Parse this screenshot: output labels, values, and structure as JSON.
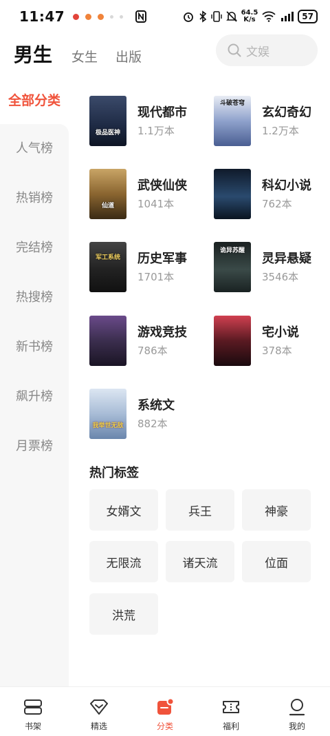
{
  "status_bar": {
    "time": "11:47",
    "speed_value": "64.5",
    "speed_unit": "K/s",
    "battery": "57"
  },
  "header": {
    "tabs": [
      {
        "label": "男生",
        "active": true
      },
      {
        "label": "女生",
        "active": false
      },
      {
        "label": "出版",
        "active": false
      }
    ],
    "search_placeholder": "文娱"
  },
  "sidebar": {
    "active": "全部分类",
    "items": [
      "人气榜",
      "热销榜",
      "完结榜",
      "热搜榜",
      "新书榜",
      "飙升榜",
      "月票榜"
    ]
  },
  "categories": [
    {
      "name": "现代都市",
      "count": "1.1万本",
      "cover_title": "极品医神",
      "cover_color": "#1e2a44"
    },
    {
      "name": "玄幻奇幻",
      "count": "1.2万本",
      "cover_title": "斗破苍穹",
      "cover_color": "#6b7fb0"
    },
    {
      "name": "武侠仙侠",
      "count": "1041本",
      "cover_title": "仙道",
      "cover_color": "#6b4a22"
    },
    {
      "name": "科幻小说",
      "count": "762本",
      "cover_title": "",
      "cover_color": "#1a2e44"
    },
    {
      "name": "历史军事",
      "count": "1701本",
      "cover_title": "军工系统",
      "cover_color": "#2b2b2b"
    },
    {
      "name": "灵异悬疑",
      "count": "3546本",
      "cover_title": "诡异苏醒",
      "cover_color": "#2c3838"
    },
    {
      "name": "游戏竞技",
      "count": "786本",
      "cover_title": "",
      "cover_color": "#3b2e4e"
    },
    {
      "name": "宅小说",
      "count": "378本",
      "cover_title": "",
      "cover_color": "#5a1a22"
    },
    {
      "name": "系统文",
      "count": "882本",
      "cover_title": "我举世无敌",
      "cover_color": "#8aa6c8"
    }
  ],
  "hot_tags": {
    "title": "热门标签",
    "items": [
      "女婿文",
      "兵王",
      "神豪",
      "无限流",
      "诸天流",
      "位面",
      "洪荒"
    ]
  },
  "bottom_nav": {
    "items": [
      {
        "label": "书架",
        "icon": "bookshelf-icon",
        "active": false
      },
      {
        "label": "精选",
        "icon": "diamond-icon",
        "active": false
      },
      {
        "label": "分类",
        "icon": "category-icon",
        "active": true
      },
      {
        "label": "福利",
        "icon": "ticket-icon",
        "active": false
      },
      {
        "label": "我的",
        "icon": "profile-icon",
        "active": false
      }
    ]
  },
  "colors": {
    "accent": "#f0533b",
    "sidebar_bg": "#f7f7f7",
    "tag_bg": "#f5f5f5"
  }
}
